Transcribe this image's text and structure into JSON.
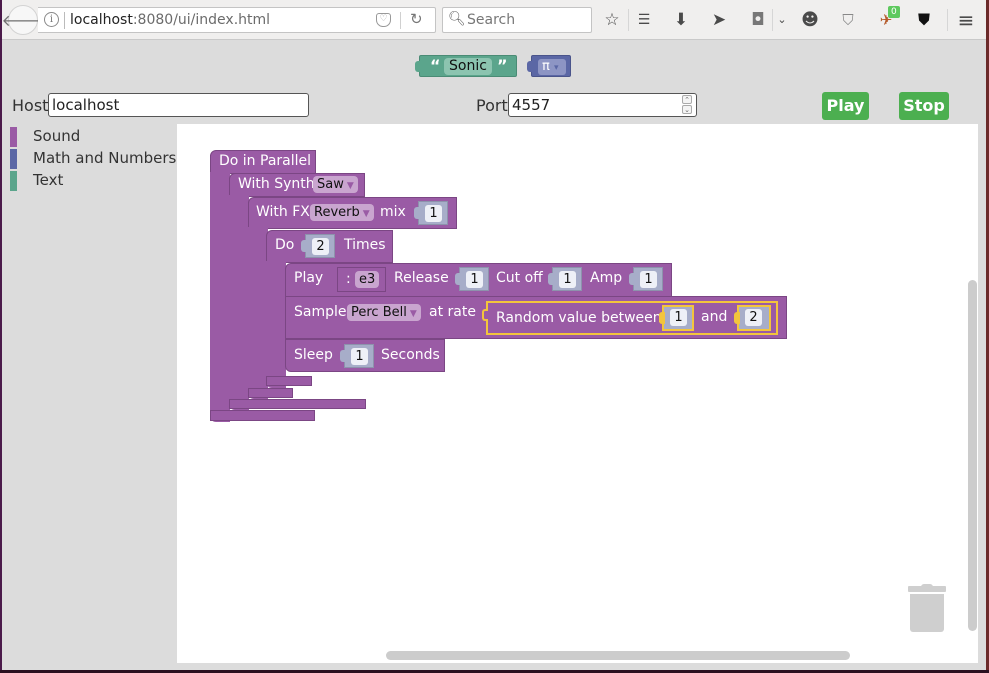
{
  "browser": {
    "url_host": "localhost",
    "url_rest": ":8080/ui/index.html",
    "search_placeholder": "Search",
    "badge_count": "0",
    "icons": [
      "back-icon",
      "info-icon",
      "pocket-icon",
      "reload-icon",
      "search-icon",
      "bookmark-star-icon",
      "reading-list-icon",
      "download-icon",
      "send-icon",
      "pocket-icon",
      "chevron-down-icon",
      "chat-icon",
      "ublock-icon",
      "extension-icon",
      "wot-icon",
      "menu-icon"
    ]
  },
  "palette_blocks": {
    "text_block": {
      "open_quote": "“",
      "value": "Sonic",
      "close_quote": "”"
    },
    "math_block": {
      "value": "π",
      "arrow": "▾"
    }
  },
  "connection": {
    "host_label": "Host",
    "host_value": "localhost",
    "port_label": "Port",
    "port_value": "4557",
    "play_label": "Play",
    "stop_label": "Stop"
  },
  "toolbox": {
    "categories": [
      {
        "label": "Sound",
        "color": "#9a5ba5"
      },
      {
        "label": "Math and Numbers",
        "color": "#5b67a5"
      },
      {
        "label": "Text",
        "color": "#5ba58c"
      }
    ]
  },
  "program": {
    "parallel_label": "Do in Parallel",
    "synth_label": "With Synth",
    "synth_value": "Saw",
    "fx_label": "With FX",
    "fx_value": "Reverb",
    "fx_mix_label": "mix",
    "fx_mix_value": "1",
    "repeat_label": "Do",
    "repeat_value": "2",
    "repeat_suffix": "Times",
    "play_label": "Play",
    "play_note_prefix": ":",
    "play_note": "e3",
    "release_label": "Release",
    "release_value": "1",
    "cutoff_label": "Cut off",
    "cutoff_value": "1",
    "amp_label": "Amp",
    "amp_value": "1",
    "sample_label": "Sample",
    "sample_value": "Perc Bell",
    "rate_label": "at rate",
    "random_label": "Random value between",
    "random_min": "1",
    "random_and": "and",
    "random_max": "2",
    "sleep_label": "Sleep",
    "sleep_value": "1",
    "sleep_suffix": "Seconds"
  },
  "colors": {
    "sound": "#9a5ba5",
    "math": "#5b67a5",
    "text": "#5ba58c",
    "button": "#4caf50",
    "selection": "#f3c53c"
  }
}
